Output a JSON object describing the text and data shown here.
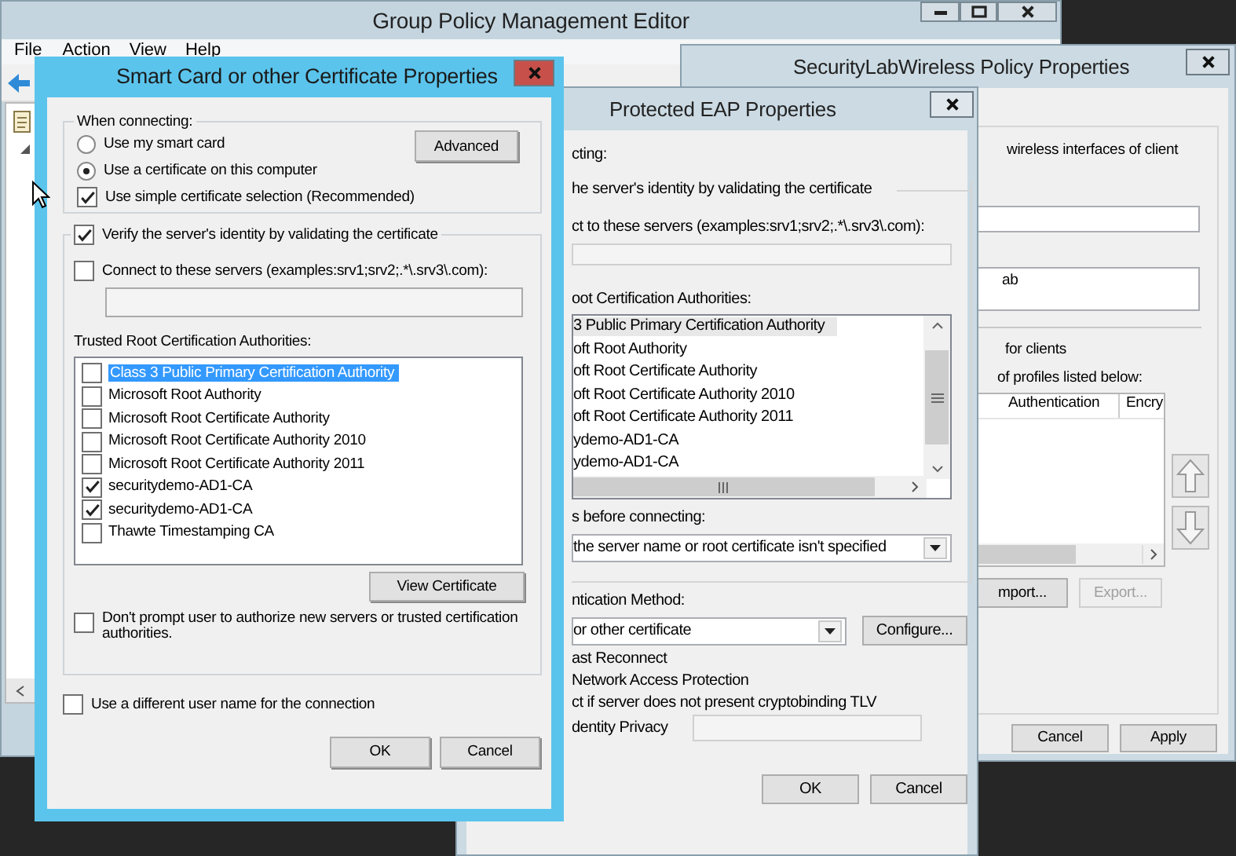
{
  "editor": {
    "title": "Group Policy Management Editor",
    "menu": [
      "File",
      "Action",
      "View",
      "Help"
    ]
  },
  "wireless_policy": {
    "title": "SecurityLabWireless Policy Properties",
    "description": "wireless interfaces of client",
    "text_value": "ab",
    "option_label": "for clients",
    "profiles_label": "of profiles listed below:",
    "columns": [
      "Authentication",
      "Encry"
    ],
    "profile_buttons": [
      {
        "label": "mport...",
        "disabled": false
      },
      {
        "label": "Export...",
        "disabled": true
      }
    ],
    "buttons": [
      "Cancel",
      "Apply"
    ]
  },
  "peap": {
    "title": "Protected EAP Properties",
    "group_label": "cting:",
    "verify_label": "he server's identity by validating the certificate",
    "connect_label": "ct to these servers (examples:srv1;srv2;.*\\.srv3\\.com):",
    "trusted_label": "oot Certification Authorities:",
    "authorities": [
      {
        "name": "3 Public Primary Certification Authority",
        "selected": true
      },
      {
        "name": "oft Root Authority",
        "selected": false
      },
      {
        "name": "oft Root Certificate Authority",
        "selected": false
      },
      {
        "name": "oft Root Certificate Authority 2010",
        "selected": false
      },
      {
        "name": "oft Root Certificate Authority 2011",
        "selected": false
      },
      {
        "name": "ydemo-AD1-CA",
        "selected": false
      },
      {
        "name": "ydemo-AD1-CA",
        "selected": false
      }
    ],
    "notifications_label": "s before connecting:",
    "notifications_value": "the server name or root certificate isn't specified",
    "method_label": "ntication Method:",
    "method_value": "or other certificate",
    "configure": "Configure...",
    "options": [
      "ast Reconnect",
      "Network Access Protection",
      "ct if server does not present cryptobinding TLV"
    ],
    "identity_label": "dentity Privacy",
    "buttons": [
      "OK",
      "Cancel"
    ]
  },
  "smart_card": {
    "title": "Smart Card or other Certificate Properties",
    "when_connecting": "When connecting:",
    "modes": [
      {
        "label": "Use my smart card",
        "selected": false
      },
      {
        "label": "Use a certificate on this computer",
        "selected": true
      }
    ],
    "advanced": "Advanced",
    "simple_selection": {
      "label": "Use simple certificate selection (Recommended)",
      "checked": true
    },
    "verify": {
      "label": "Verify the server's identity by validating the certificate",
      "checked": true
    },
    "connect": {
      "label": "Connect to these servers (examples:srv1;srv2;.*\\.srv3\\.com):",
      "checked": false
    },
    "trusted_label": "Trusted Root Certification Authorities:",
    "authorities": [
      {
        "name": "Class 3 Public Primary Certification Authority",
        "checked": false,
        "selected": true
      },
      {
        "name": "Microsoft Root Authority",
        "checked": false,
        "selected": false
      },
      {
        "name": "Microsoft Root Certificate Authority",
        "checked": false,
        "selected": false
      },
      {
        "name": "Microsoft Root Certificate Authority 2010",
        "checked": false,
        "selected": false
      },
      {
        "name": "Microsoft Root Certificate Authority 2011",
        "checked": false,
        "selected": false
      },
      {
        "name": "securitydemo-AD1-CA",
        "checked": true,
        "selected": false
      },
      {
        "name": "securitydemo-AD1-CA",
        "checked": true,
        "selected": false
      },
      {
        "name": "Thawte Timestamping CA",
        "checked": false,
        "selected": false
      }
    ],
    "view_certificate": "View Certificate",
    "dont_prompt": {
      "label": "Don't prompt user to authorize new servers or trusted certification authorities.",
      "checked": false
    },
    "different_user": {
      "label": "Use a different user name for the connection",
      "checked": false
    },
    "buttons": [
      "OK",
      "Cancel"
    ]
  }
}
